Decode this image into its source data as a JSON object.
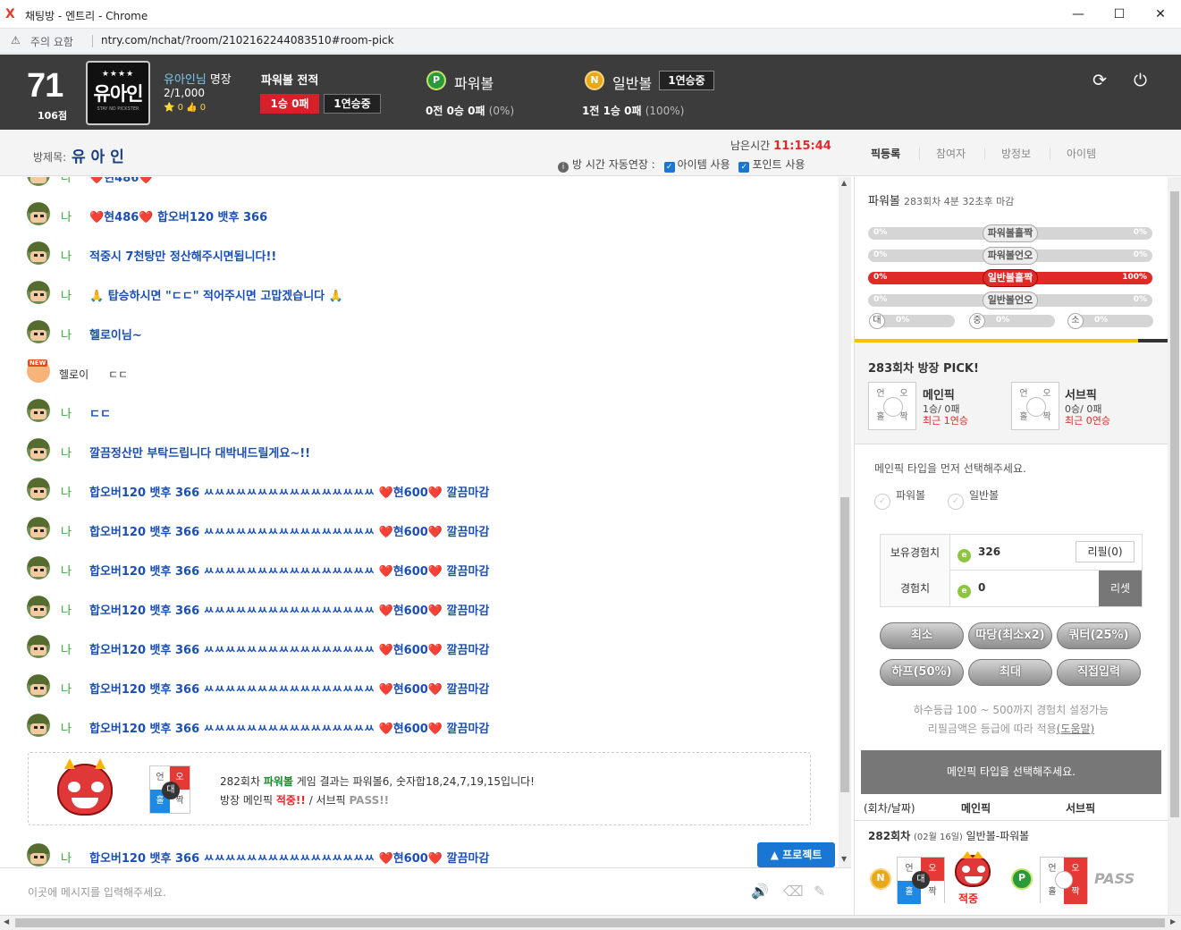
{
  "window": {
    "title": "채팅방 - 엔트리 - Chrome",
    "logo": "X"
  },
  "address": {
    "security": "주의 요함",
    "url": "ntry.com/nchat/?room/2102162244083510#room-pick"
  },
  "user": {
    "level": "71",
    "level_sub": "106점",
    "avatar_stars": "★★★★",
    "avatar_name": "유아인",
    "avatar_small": "STAY NO PICKSTER",
    "name": "유아인님",
    "grade": "명장",
    "count": "2/1,000",
    "stats": "⭐ 0 👍 0"
  },
  "record": {
    "title": "파워볼 전적",
    "win_loss": "1승 0패",
    "streak": "1연승중"
  },
  "powerball": {
    "ball": "P",
    "label": "파워볼",
    "result": "0전 0승 0패",
    "pct": "(0%)"
  },
  "normalball": {
    "ball": "N",
    "label": "일반볼",
    "result": "1전 1승 0패",
    "pct": "(100%)",
    "badge": "1연승중"
  },
  "room": {
    "title_label": "방제목:",
    "title": "유 아 인",
    "remain_label": "남은시간",
    "remain": "11:15:44",
    "auto_extend": "방 시간 자동연장 :",
    "item_use": "아이템 사용",
    "point_use": "포인트 사용"
  },
  "tabs": [
    "픽등록",
    "참여자",
    "방정보",
    "아이템"
  ],
  "chat": {
    "me": "나",
    "rows": [
      {
        "t": "❤️현486❤️ 합오버120 뱃후 366"
      },
      {
        "t": "적중시 7천탕만 정산해주시면됩니다!!"
      },
      {
        "t": "🙏 탑승하시면 \"ㄷㄷ\" 적어주시면 고맙겠습니다 🙏"
      },
      {
        "t": "헬로이님~"
      },
      {
        "t": "ㄷㄷ"
      },
      {
        "t": "깔끔정산만 부탁드립니다 대박내드릴게요~!!"
      },
      {
        "t": "합오버120 뱃후 366 ㅆㅆㅆㅆㅆㅆㅆㅆㅆㅆㅆㅆㅆㅆㅆㅆ ❤️현600❤️ 깔끔마감"
      }
    ],
    "partial_top": "❤️현486❤️",
    "other_name": "헬로이",
    "other_text": "ㄷㄷ",
    "new_tag": "NEW",
    "result_l1_a": "282회차 ",
    "result_l1_b": "파워볼",
    "result_l1_c": " 게임 결과는 파워볼6, 숫자합18,24,7,19,15입니다!",
    "result_l2_a": "방장 메인픽 ",
    "result_l2_b": "적중!!",
    "result_l2_c": " / 서브픽 ",
    "result_l2_d": "PASS!!",
    "board": {
      "un": "언",
      "o": "오",
      "hol": "홀",
      "jjak": "짝",
      "dae": "대"
    },
    "protect": "▲ 프로젝트",
    "input_placeholder": "이곳에 메시지를 입력해주세요."
  },
  "side": {
    "round_label": "파워볼",
    "round": "283회차 4분 32초후 마감",
    "bars": [
      {
        "name": "파워볼홀짝",
        "left": "0%",
        "right": "0%",
        "fill": 0
      },
      {
        "name": "파워볼언오",
        "left": "0%",
        "right": "0%",
        "fill": 0
      },
      {
        "name": "일반볼홀짝",
        "left": "0%",
        "right": "100%",
        "fill": 100
      },
      {
        "name": "일반볼언오",
        "left": "0%",
        "right": "0%",
        "fill": 0
      }
    ],
    "mini": [
      {
        "lb": "대",
        "pv": "0%"
      },
      {
        "lb": "중",
        "pv": "0%"
      },
      {
        "lb": "소",
        "pv": "0%"
      }
    ],
    "pick_title": "283회차 방장 PICK!",
    "main_pick": {
      "title": "메인픽",
      "score": "1승/ 0패",
      "recent": "최근 1연승"
    },
    "sub_pick": {
      "title": "서브픽",
      "score": "0승/ 0패",
      "recent": "최근 0연승"
    },
    "notice": "메인픽 타입을 먼저 선택해주세요.",
    "radio": [
      "파워볼",
      "일반볼"
    ],
    "exp_label": "보유경험치",
    "exp_value": "326",
    "refill": "리필(0)",
    "exp2_label": "경험치",
    "exp2_value": "0",
    "reset": "리셋",
    "buttons": [
      "최소",
      "따당(최소x2)",
      "쿼터(25%)",
      "하프(50%)",
      "최대",
      "직접입력"
    ],
    "hint1": "하수등급 100 ~ 500까지 경험치 설정가능",
    "hint2a": "리필금액은 등급에 따라 적용",
    "hint2b": "(도움말)",
    "select": "메인픽 타입을 선택해주세요.",
    "list_head": [
      "(회차/날짜)",
      "메인픽",
      "서브픽"
    ],
    "list_row": {
      "round": "282회차",
      "date": "(02월 16일)",
      "type": "일반볼-파워볼",
      "hit": "적중",
      "pass": "PASS"
    }
  }
}
